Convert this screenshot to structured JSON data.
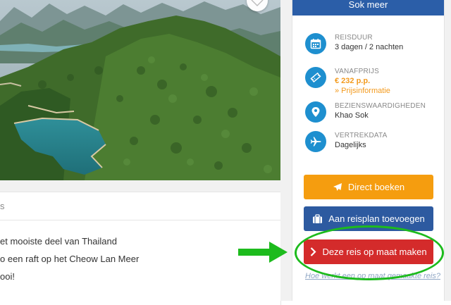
{
  "left": {
    "tab_label": "s",
    "highlights": [
      "et mooiste deel van Thailand",
      "o een raft op het Cheow Lan Meer",
      "ooi!"
    ]
  },
  "sidebar": {
    "title": "Sok meer",
    "items": [
      {
        "label": "REISDUUR",
        "value": "3 dagen / 2 nachten",
        "icon": "calendar-icon"
      },
      {
        "label": "VANAFPRIJS",
        "value": "€ 232 p.p.",
        "link": "» Prijsinformatie",
        "icon": "ticket-icon"
      },
      {
        "label": "BEZIENSWAARDIGHEDEN",
        "value": "Khao Sok",
        "icon": "location-pin-icon"
      },
      {
        "label": "VERTREKDATA",
        "value": "Dagelijks",
        "icon": "airplane-icon"
      }
    ],
    "buttons": {
      "book": "Direct boeken",
      "add_plan": "Aan reisplan toevoegen",
      "custom": "Deze reis op maat maken"
    },
    "bottom_link": "Hoe werkt een op maat gemaakte reis?"
  },
  "colors": {
    "accent_blue": "#2b5ea8",
    "icon_blue": "#1e8fcf",
    "orange": "#f59d0f",
    "red": "#d42b2b",
    "annotation_green": "#1dbb1d"
  }
}
